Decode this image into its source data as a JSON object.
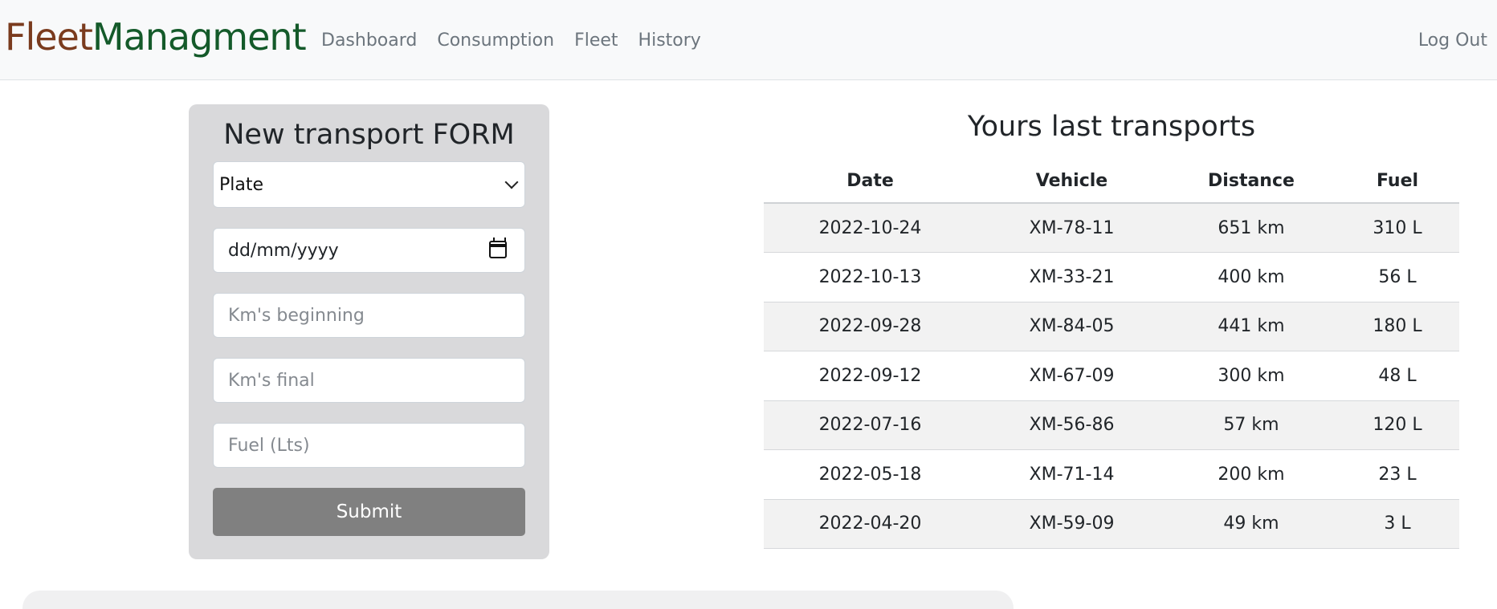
{
  "navbar": {
    "brand_part1": "Fleet",
    "brand_part2": "Managment",
    "links": [
      "Dashboard",
      "Consumption",
      "Fleet",
      "History"
    ],
    "logout": "Log Out"
  },
  "form": {
    "title": "New transport FORM",
    "plate_selected": "Plate",
    "date_placeholder": "dd/mm/yyyy",
    "km_beginning_placeholder": "Km's beginning",
    "km_final_placeholder": "Km's final",
    "fuel_placeholder": "Fuel (Lts)",
    "submit_label": "Submit"
  },
  "transports": {
    "title": "Yours last transports",
    "headers": [
      "Date",
      "Vehicle",
      "Distance",
      "Fuel"
    ],
    "rows": [
      [
        "2022-10-24",
        "XM-78-11",
        "651 km",
        "310 L"
      ],
      [
        "2022-10-13",
        "XM-33-21",
        "400 km",
        "56 L"
      ],
      [
        "2022-09-28",
        "XM-84-05",
        "441 km",
        "180 L"
      ],
      [
        "2022-09-12",
        "XM-67-09",
        "300 km",
        "48 L"
      ],
      [
        "2022-07-16",
        "XM-56-86",
        "57 km",
        "120 L"
      ],
      [
        "2022-05-18",
        "XM-71-14",
        "200 km",
        "23 L"
      ],
      [
        "2022-04-20",
        "XM-59-09",
        "49 km",
        "3 L"
      ]
    ]
  },
  "colors": {
    "brand_part1": "#7a3b1e",
    "brand_part2": "#145a2a",
    "form_card_bg": "#d9d9db",
    "submit_bg": "#808080",
    "stripe_bg": "#f2f2f2"
  }
}
